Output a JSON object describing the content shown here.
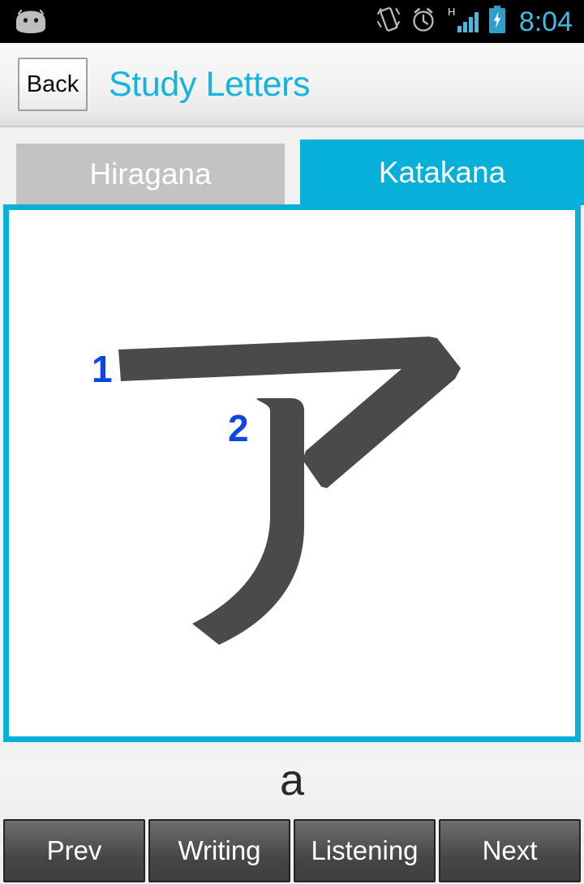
{
  "status_bar": {
    "icons": [
      "android-robot-icon",
      "vibrate-icon",
      "alarm-clock-icon",
      "signal-h-icon",
      "battery-charging-icon"
    ],
    "signal_label": "H",
    "time": "8:04",
    "time_color": "#3bbce0",
    "background": "#000000"
  },
  "action_bar": {
    "back_label": "Back",
    "title": "Study Letters",
    "title_color": "#14b4dc"
  },
  "tabs": {
    "items": [
      {
        "label": "Hiragana",
        "active": false,
        "color": "#c3c3c3"
      },
      {
        "label": "Katakana",
        "active": true,
        "color": "#06b0d8"
      }
    ]
  },
  "card": {
    "border_color": "#06b0d8",
    "background": "#ffffff",
    "glyph": "ア",
    "glyph_script": "Katakana",
    "stroke_color": "#4a4a4a",
    "stroke_number_color": "#0b47e0",
    "stroke_numbers": [
      "1",
      "2"
    ],
    "stroke_count": 2
  },
  "romaji": {
    "text": "a"
  },
  "bottom_buttons": {
    "items": [
      {
        "label": "Prev"
      },
      {
        "label": "Writing"
      },
      {
        "label": "Listening"
      },
      {
        "label": "Next"
      }
    ]
  }
}
